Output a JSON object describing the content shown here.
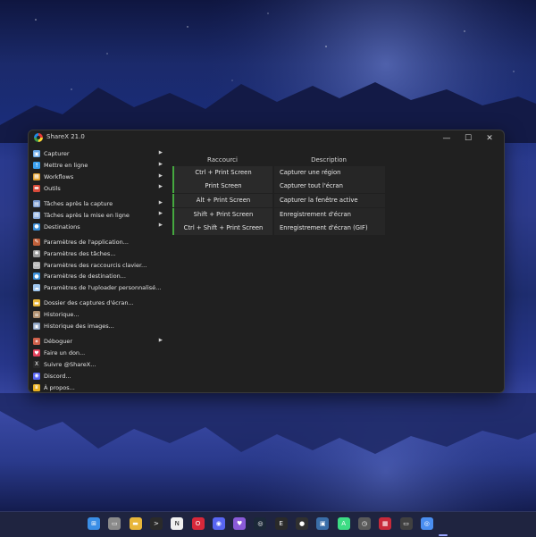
{
  "window": {
    "title": "ShareX 21.0"
  },
  "titlebar": {
    "minimize_glyph": "—",
    "maximize_glyph": "☐",
    "close_glyph": "✕"
  },
  "menu": {
    "groups": [
      [
        {
          "label": "Capturer",
          "icon": "camera-icon",
          "submenu": true
        },
        {
          "label": "Mettre en ligne",
          "icon": "upload-arrow-icon",
          "submenu": true
        },
        {
          "label": "Workflows",
          "icon": "workflows-grid-icon",
          "submenu": true
        },
        {
          "label": "Outils",
          "icon": "toolbox-icon",
          "submenu": true
        }
      ],
      [
        {
          "label": "Tâches après la capture",
          "icon": "image-task-icon",
          "submenu": true
        },
        {
          "label": "Tâches après la mise en ligne",
          "icon": "upload-task-icon",
          "submenu": true
        },
        {
          "label": "Destinations",
          "icon": "globe-icon",
          "submenu": true
        }
      ],
      [
        {
          "label": "Paramètres de l'application...",
          "icon": "wrench-icon",
          "submenu": false
        },
        {
          "label": "Paramètres des tâches...",
          "icon": "gear-icon",
          "submenu": false
        },
        {
          "label": "Paramètres des raccourcis clavier...",
          "icon": "keyboard-icon",
          "submenu": false
        },
        {
          "label": "Paramètres de destination...",
          "icon": "globe-settings-icon",
          "submenu": false
        },
        {
          "label": "Paramètres de l'uploader personnalisé...",
          "icon": "cloud-icon",
          "submenu": false
        }
      ],
      [
        {
          "label": "Dossier des captures d'écran...",
          "icon": "folder-icon",
          "submenu": false
        },
        {
          "label": "Historique...",
          "icon": "history-list-icon",
          "submenu": false
        },
        {
          "label": "Historique des images...",
          "icon": "image-history-icon",
          "submenu": false
        }
      ],
      [
        {
          "label": "Déboguer",
          "icon": "bug-icon",
          "submenu": true
        },
        {
          "label": "Faire un don...",
          "icon": "heart-icon",
          "submenu": false
        },
        {
          "label": "Suivre @ShareX...",
          "icon": "x-logo-icon",
          "submenu": false
        },
        {
          "label": "Discord...",
          "icon": "discord-icon",
          "submenu": false
        },
        {
          "label": "À propos...",
          "icon": "crown-icon",
          "submenu": false
        }
      ]
    ]
  },
  "hotkeys": {
    "header_key": "Raccourci",
    "header_desc": "Description",
    "rows": [
      {
        "key": "Ctrl + Print Screen",
        "desc": "Capturer une région"
      },
      {
        "key": "Print Screen",
        "desc": "Capturer tout l'écran"
      },
      {
        "key": "Alt + Print Screen",
        "desc": "Capturer la fenêtre active"
      },
      {
        "key": "Shift + Print Screen",
        "desc": "Enregistrement d'écran"
      },
      {
        "key": "Ctrl + Shift + Print Screen",
        "desc": "Enregistrement d'écran (GIF)"
      }
    ],
    "indicator_color": "#45a83f"
  },
  "taskbar": {
    "icons": [
      "windows-start-icon",
      "task-view-icon",
      "file-explorer-icon",
      "terminal-icon",
      "notion-icon",
      "opera-icon",
      "discord-icon",
      "heart-app-icon",
      "steam-icon",
      "epic-games-icon",
      "obs-icon",
      "sharex-capture-icon",
      "android-studio-icon",
      "clock-icon",
      "stream-deck-icon",
      "monitor-icon",
      "sharex-icon"
    ]
  },
  "colors": {
    "accent": "#45a83f",
    "window_bg": "#202020",
    "taskbar_bg": "#1f2440"
  }
}
